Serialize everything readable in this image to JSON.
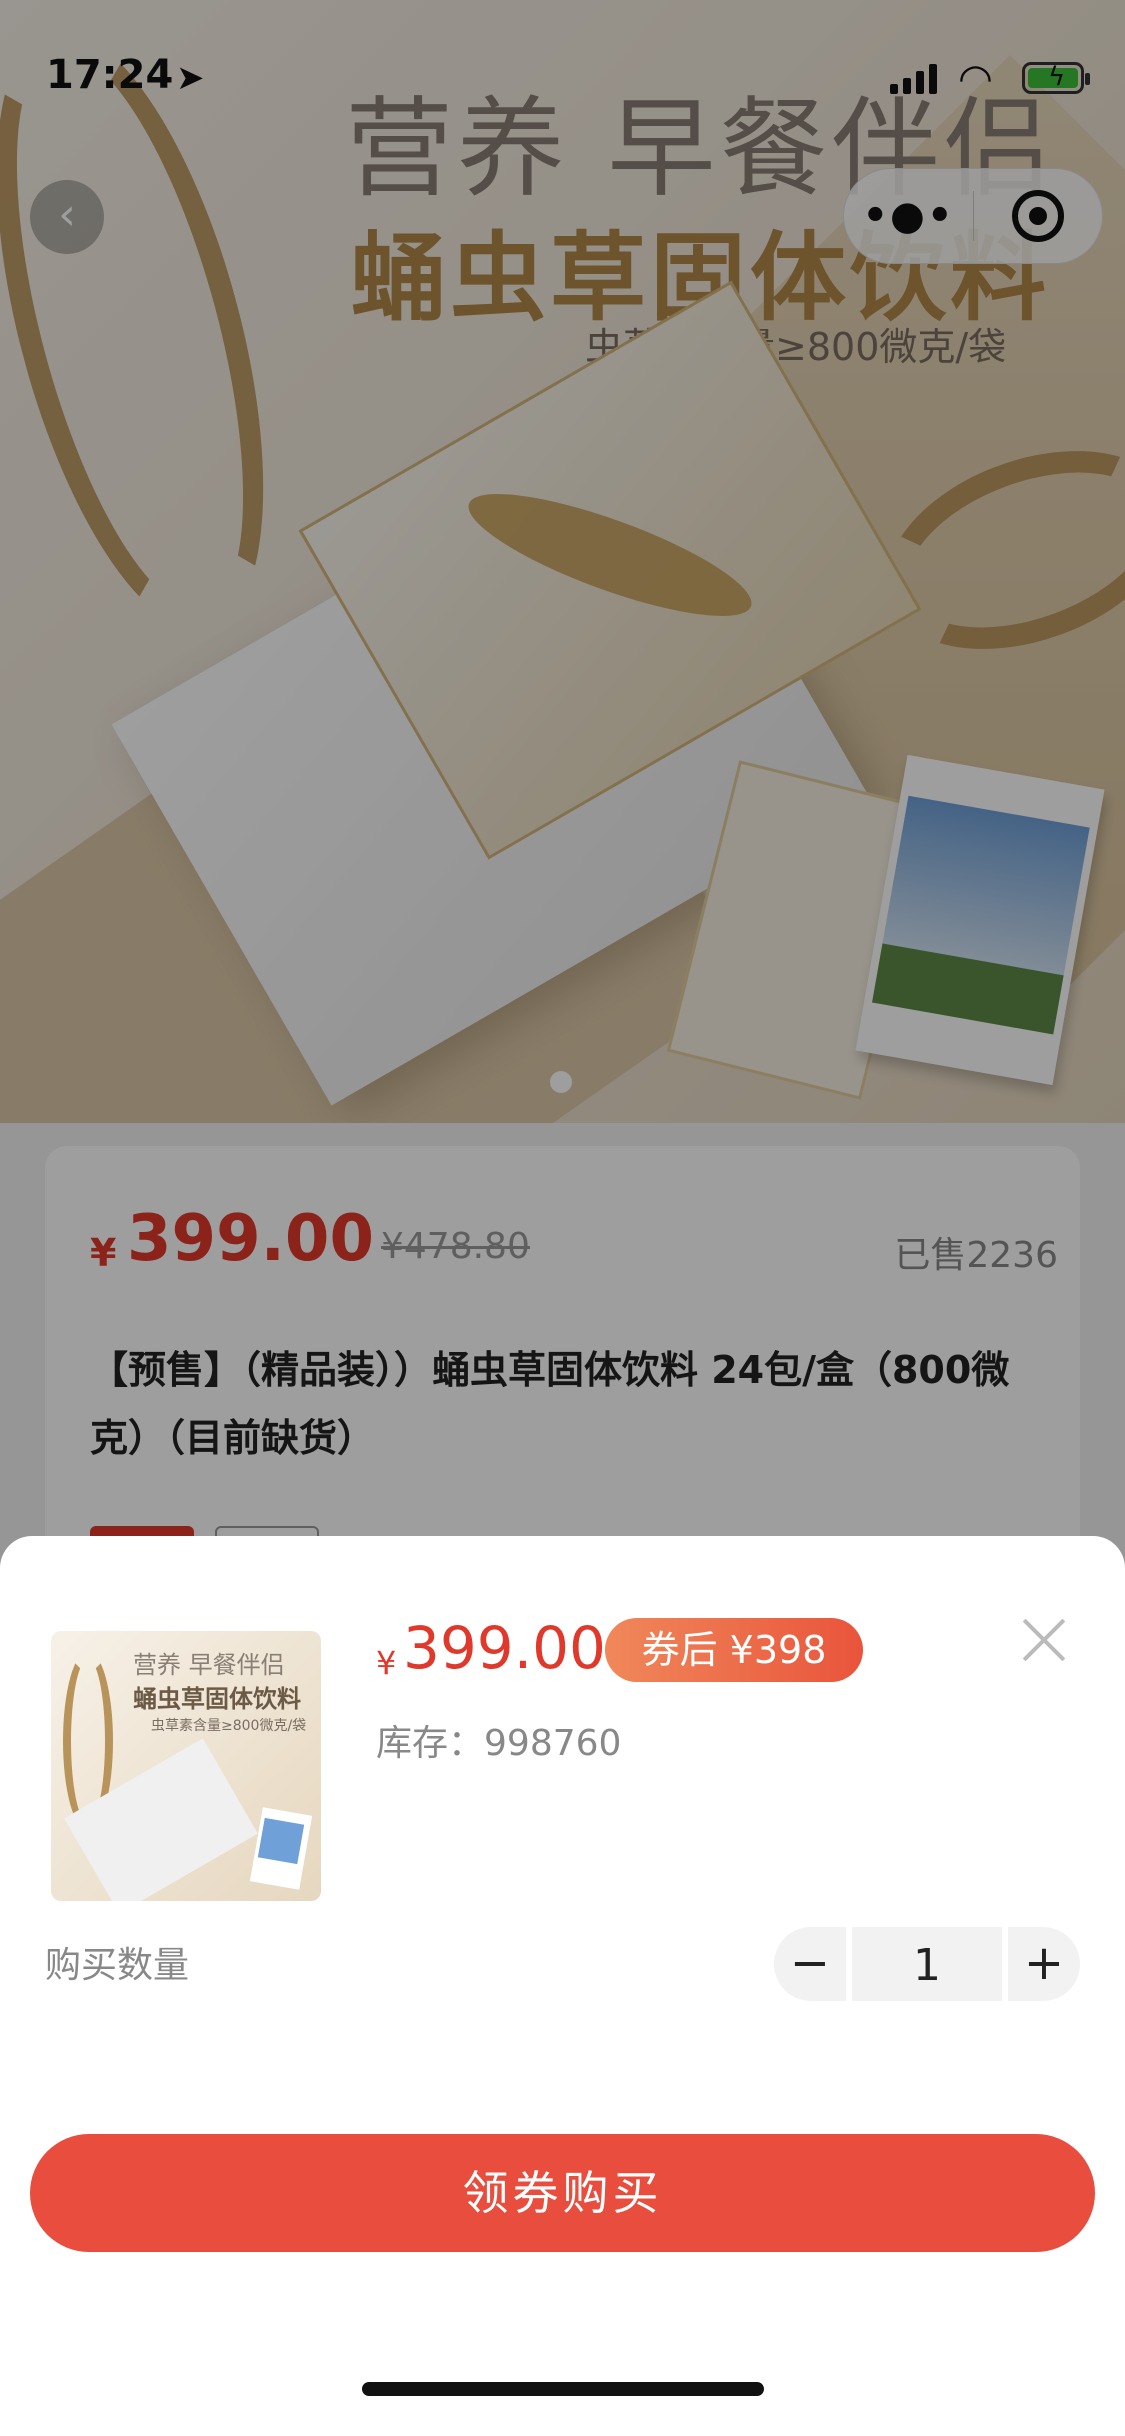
{
  "status_bar": {
    "time": "17:24"
  },
  "hero": {
    "headline_1": "营养 早餐伴侣",
    "headline_2": "蛹虫草固体饮料",
    "headline_3": "虫草素含量≥800微克/袋"
  },
  "product": {
    "currency": "¥",
    "price": "399.00",
    "original_price": "¥478.80",
    "sold": "已售2236",
    "title": "【预售】（精品装））蛹虫草固体饮料 24包/盒（800微克）（目前缺货）"
  },
  "sheet": {
    "currency": "¥",
    "price": "399.00",
    "coupon_price": "券后 ¥398",
    "stock_label": "库存：",
    "stock_value": "998760",
    "quantity_label": "购买数量",
    "quantity_value": "1",
    "minus": "−",
    "plus": "+",
    "buy_button": "领券购买",
    "thumb": {
      "line1": "营养 早餐伴侣",
      "line2": "蛹虫草固体饮料",
      "line3": "虫草素含量≥800微克/袋"
    }
  },
  "colors": {
    "accent_red": "#e0392b",
    "button_red": "#e84d3d",
    "coupon_gradient_start": "#f0885a",
    "coupon_gradient_end": "#e9543b"
  },
  "icons": {
    "back": "chevron-left-icon",
    "more": "more-dots-icon",
    "close_mini": "target-icon",
    "sheet_close": "close-icon"
  }
}
